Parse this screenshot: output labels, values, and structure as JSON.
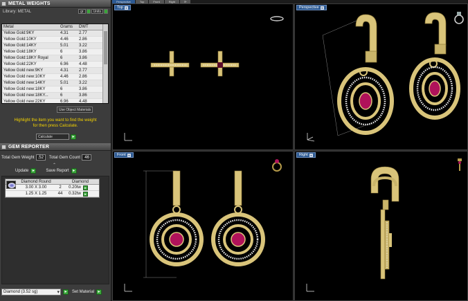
{
  "view_tabs": [
    "Perspective",
    "Top",
    "Front",
    "Right",
    "⟳"
  ],
  "metal_weights": {
    "title": "METAL WEIGHTS",
    "library_label": "Library: METAL",
    "unit_buttons": [
      "gr",
      "Units"
    ],
    "columns": [
      "Metal",
      "Grams",
      "DWT"
    ],
    "rows": [
      {
        "metal": "Yellow Gold:9KY",
        "grams": "4.31",
        "dwt": "2.77"
      },
      {
        "metal": "Yellow Gold:10KY",
        "grams": "4.46",
        "dwt": "2.86"
      },
      {
        "metal": "Yellow Gold:14KY",
        "grams": "5.01",
        "dwt": "3.22"
      },
      {
        "metal": "Yellow Gold:18KY",
        "grams": "6",
        "dwt": "3.86"
      },
      {
        "metal": "Yellow Gold:18KY Royal",
        "grams": "6",
        "dwt": "3.86"
      },
      {
        "metal": "Yellow Gold:22KY",
        "grams": "6.96",
        "dwt": "4.48"
      },
      {
        "metal": "Yellow Gold new:9KY",
        "grams": "4.31",
        "dwt": "2.77"
      },
      {
        "metal": "Yellow Gold new:10KY",
        "grams": "4.46",
        "dwt": "2.86"
      },
      {
        "metal": "Yellow Gold new:14KY",
        "grams": "5.01",
        "dwt": "3.22"
      },
      {
        "metal": "Yellow Gold new:18KY",
        "grams": "6",
        "dwt": "3.86"
      },
      {
        "metal": "Yellow Gold new:18KY...",
        "grams": "6",
        "dwt": "3.86"
      },
      {
        "metal": "Yellow Gold new:22KY",
        "grams": "6.96",
        "dwt": "4.48"
      }
    ],
    "use_object_materials": "Use Object Materials",
    "hint_line1": "Highlight the item you want to find the weight",
    "hint_line2": "for then press Calculate.",
    "calculate_label": "Calculate"
  },
  "gem_reporter": {
    "title": "GEM REPORTER",
    "total_weight_label": "Total Gem Weight",
    "total_weight_value": ".52",
    "total_count_label": "Total Gem Count",
    "total_count_value": "46",
    "update_label": "Update",
    "save_report_label": "Save Report",
    "columns": [
      "Diamond Round",
      "Diamond"
    ],
    "rows": [
      {
        "size": "3.00 X 3.00",
        "qty": "2",
        "weight": "0.20tw"
      },
      {
        "size": "1.25 X 1.25",
        "qty": "44",
        "weight": "0.32tw"
      }
    ]
  },
  "material_select": "Diamond (3.52 sg)",
  "set_material_label": "Set Material",
  "viewports": {
    "top": "Top",
    "perspective": "Perspective",
    "front": "Front",
    "right": "Right"
  },
  "colors": {
    "gold": "#d9c47a",
    "gold_dark": "#8f7a3a",
    "ruby": "#b0125a",
    "hint_yellow": "#f5d400",
    "label_blue": "#2d5a93"
  }
}
